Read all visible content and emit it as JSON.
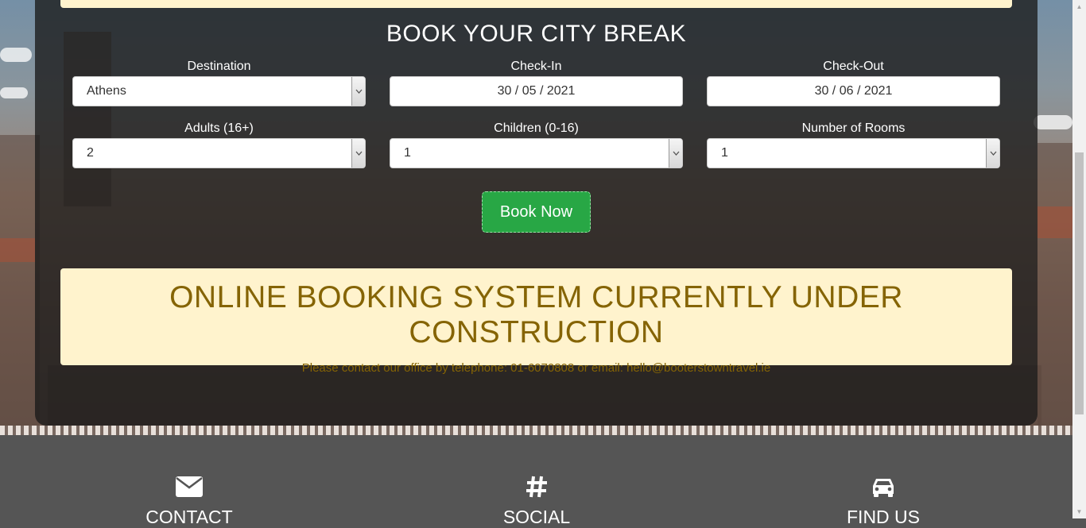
{
  "booking": {
    "title": "BOOK YOUR CITY BREAK",
    "destination": {
      "label": "Destination",
      "value": "Athens"
    },
    "check_in": {
      "label": "Check-In",
      "value": "30 / 05 / 2021"
    },
    "check_out": {
      "label": "Check-Out",
      "value": "30 / 06 / 2021"
    },
    "adults": {
      "label": "Adults (16+)",
      "value": "2"
    },
    "children": {
      "label": "Children (0-16)",
      "value": "1"
    },
    "rooms": {
      "label": "Number of Rooms",
      "value": "1"
    },
    "submit_label": "Book Now"
  },
  "notice": {
    "heading": "ONLINE BOOKING SYSTEM CURRENTLY UNDER CONSTRUCTION",
    "message": "Please contact our office by telephone: 01-6070808 or email: hello@booterstowntravel.ie"
  },
  "footer": {
    "contact": {
      "label": "CONTACT",
      "icon": "envelope-icon"
    },
    "social": {
      "label": "SOCIAL",
      "icon": "hashtag-icon"
    },
    "find_us": {
      "label": "FIND US",
      "icon": "car-icon"
    }
  },
  "colors": {
    "button_green": "#28a745",
    "notice_bg": "#fff3cd",
    "notice_text": "#856404",
    "footer_bg": "#555555"
  }
}
